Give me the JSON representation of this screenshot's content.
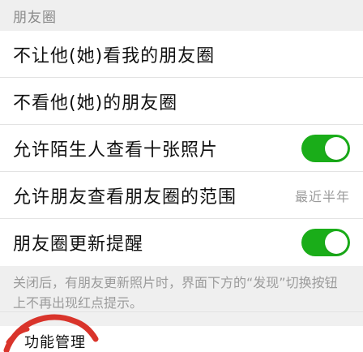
{
  "section": {
    "title": "朋友圈"
  },
  "rows": {
    "dont_let_view": {
      "label": "不让他(她)看我的朋友圈"
    },
    "dont_view": {
      "label": "不看他(她)的朋友圈"
    },
    "allow_strangers": {
      "label": "允许陌生人查看十张照片"
    },
    "allow_friends_range": {
      "label": "允许朋友查看朋友圈的范围",
      "value": "最近半年"
    },
    "moments_update": {
      "label": "朋友圈更新提醒"
    }
  },
  "note": {
    "text": "关闭后，有朋友更新照片时，界面下方的“发现”切换按钮上不再出现红点提示。"
  },
  "bottom": {
    "label": "功能管理"
  },
  "colors": {
    "toggle_on": "#1aad19",
    "annotation": "#d9342b"
  }
}
